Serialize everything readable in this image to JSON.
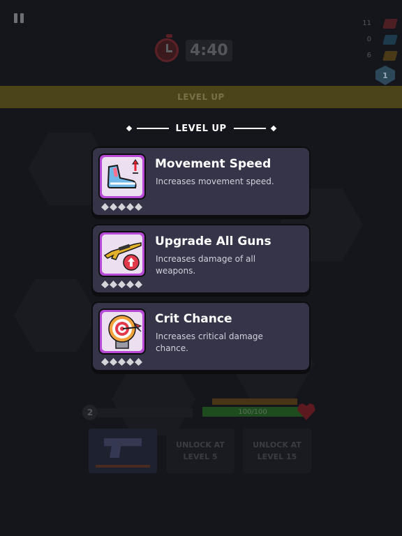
{
  "hud": {
    "timer": "4:40",
    "currency": [
      {
        "count": "11",
        "icon": "red-gem-icon",
        "color": "#4d1e22"
      },
      {
        "count": "0",
        "icon": "blue-gem-icon",
        "color": "#1d3a4d"
      },
      {
        "count": "6",
        "icon": "gold-gem-icon",
        "color": "#4a3a18"
      }
    ],
    "shield_level": "1",
    "banner": "LEVEL UP"
  },
  "level_up": {
    "header": "LEVEL UP",
    "cards": [
      {
        "name": "Movement Speed",
        "description": "Increases movement speed.",
        "icon": "sneaker-speed-icon",
        "stars": 5
      },
      {
        "name": "Upgrade All Guns",
        "description": "Increases damage of all weapons.",
        "icon": "rifle-upgrade-icon",
        "stars": 5
      },
      {
        "name": "Crit Chance",
        "description": "Increases critical damage chance.",
        "icon": "target-dart-icon",
        "stars": 5
      }
    ]
  },
  "player": {
    "level": "2",
    "health": "100/100"
  },
  "weapon_slots": [
    {
      "type": "weapon",
      "icon": "pistol-icon"
    },
    {
      "type": "locked",
      "label": "UNLOCK AT LEVEL 5"
    },
    {
      "type": "locked",
      "label": "UNLOCK AT LEVEL 15"
    }
  ],
  "colors": {
    "card_bg": "#353448",
    "icon_border": "#b64ad6",
    "banner_bg": "#4a4418"
  }
}
